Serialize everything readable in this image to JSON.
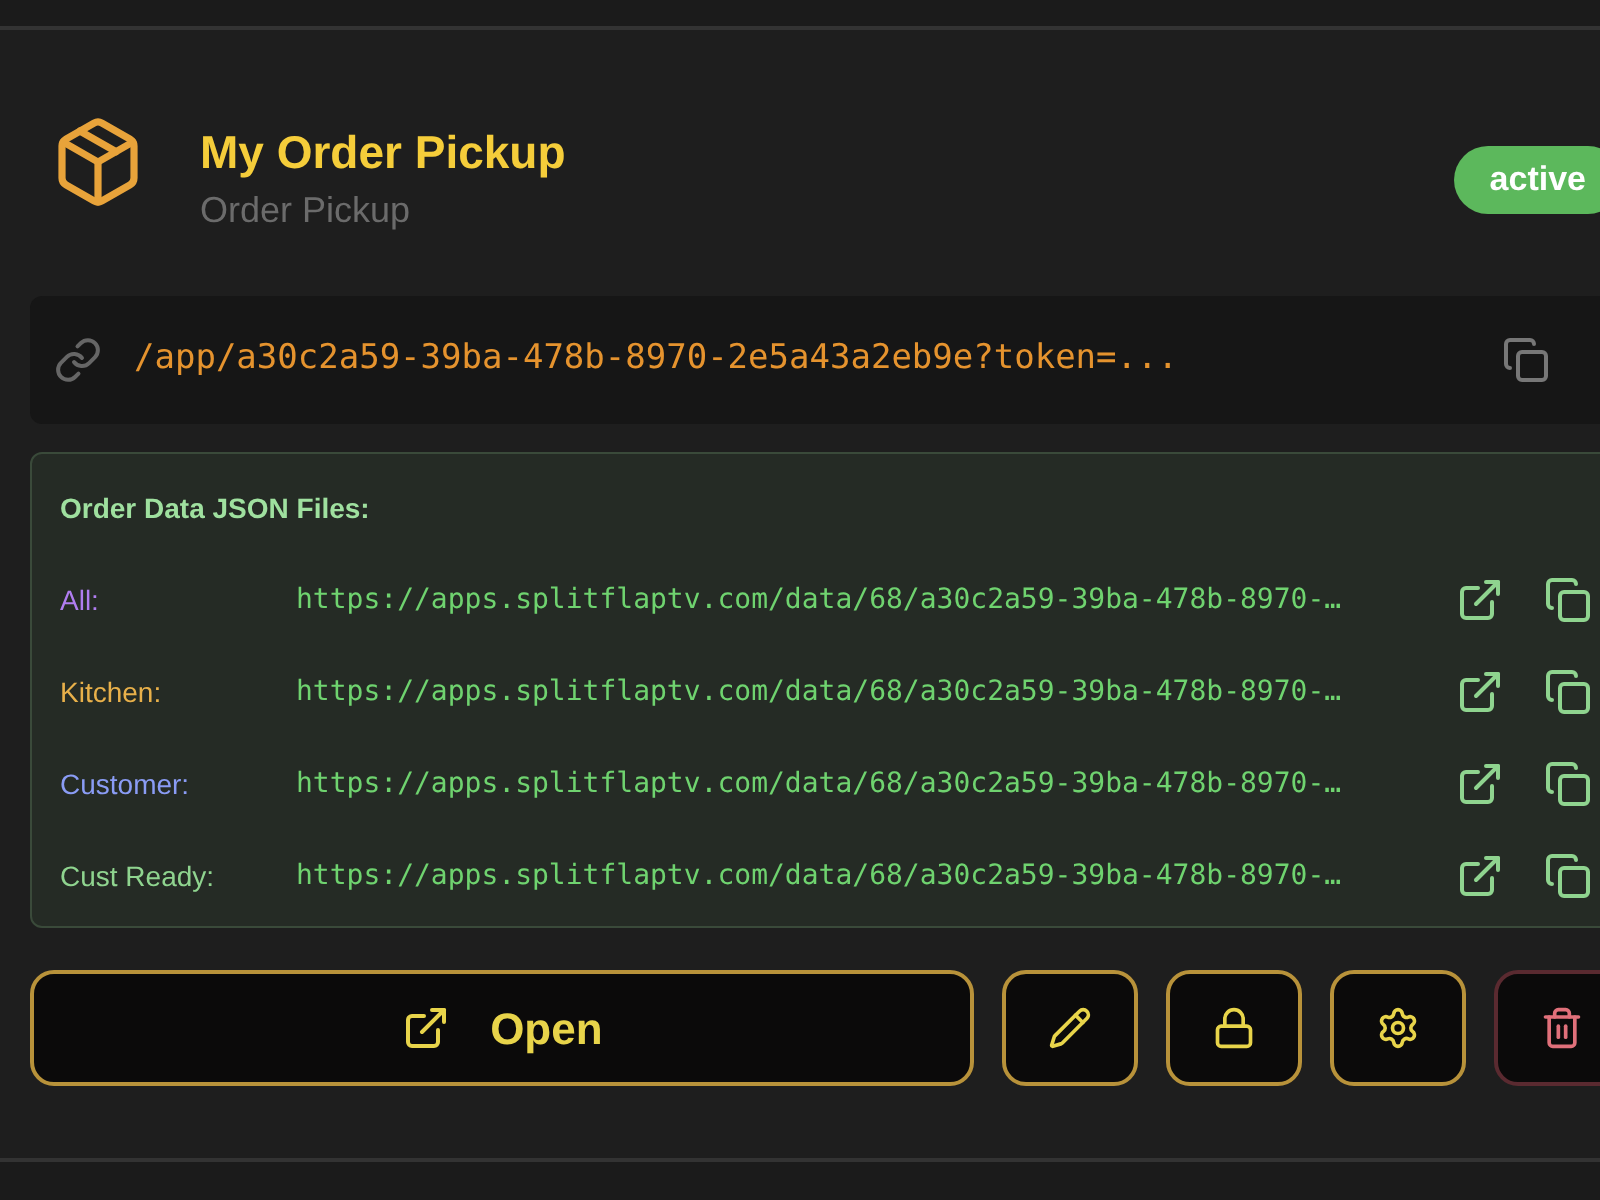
{
  "app": {
    "title": "My Order Pickup",
    "subtitle": "Order Pickup",
    "status": "active",
    "url": "/app/a30c2a59-39ba-478b-8970-2e5a43a2eb9e?token=..."
  },
  "json_files": {
    "title": "Order Data JSON Files:",
    "rows": [
      {
        "label": "All:",
        "color": "#b07df0",
        "url": "https://apps.splitflaptv.com/data/68/a30c2a59-39ba-478b-8970-…"
      },
      {
        "label": "Kitchen:",
        "color": "#e8b04a",
        "url": "https://apps.splitflaptv.com/data/68/a30c2a59-39ba-478b-8970-…"
      },
      {
        "label": "Customer:",
        "color": "#8a9cf5",
        "url": "https://apps.splitflaptv.com/data/68/a30c2a59-39ba-478b-8970-…"
      },
      {
        "label": "Cust Ready:",
        "color": "#8fd48f",
        "url": "https://apps.splitflaptv.com/data/68/a30c2a59-39ba-478b-8970-…"
      }
    ]
  },
  "actions": {
    "open_label": "Open",
    "buttons": [
      {
        "kind": "edit"
      },
      {
        "kind": "lock"
      },
      {
        "kind": "settings"
      },
      {
        "kind": "delete"
      }
    ]
  }
}
